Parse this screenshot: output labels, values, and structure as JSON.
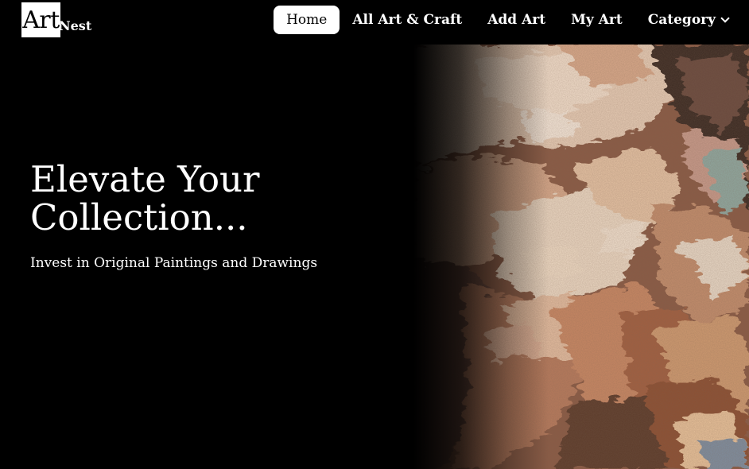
{
  "logo": {
    "mark": "Art",
    "sub": "Nest"
  },
  "nav": {
    "items": [
      {
        "label": "Home",
        "active": true
      },
      {
        "label": "All Art & Craft",
        "active": false
      },
      {
        "label": "Add Art",
        "active": false
      },
      {
        "label": "My Art",
        "active": false
      },
      {
        "label": "Category",
        "active": false,
        "has_dropdown": true
      }
    ]
  },
  "hero": {
    "title_line1": "Elevate Your",
    "title_line2": "Collection...",
    "subtitle": "Invest in Original Paintings and Drawings",
    "image": "oil-painting-portrait"
  },
  "colors": {
    "background": "#000000",
    "text": "#ffffff",
    "active_nav_bg": "#ffffff",
    "active_nav_text": "#000000"
  }
}
